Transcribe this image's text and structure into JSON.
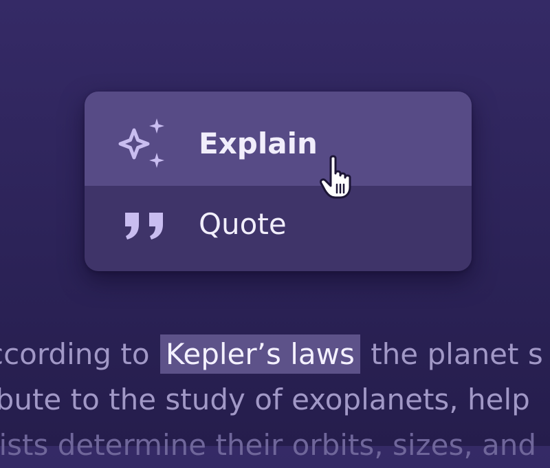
{
  "context_menu": {
    "items": [
      {
        "label": "Explain",
        "icon": "sparkles-icon",
        "active": true
      },
      {
        "label": "Quote",
        "icon": "quote-icon",
        "active": false
      }
    ]
  },
  "passage": {
    "line1_before": "ccording to",
    "line1_highlight": "Kepler’s laws",
    "line1_after": "the planet s",
    "line2": "ibute to the study of exoplanets, help",
    "line3": "tists determine their orbits, sizes, and"
  },
  "colors": {
    "background": "#2e255b",
    "menu": "#3f3469",
    "menu_hover": "#574b86",
    "icon_accent": "#c9bdf0",
    "highlight": "#5d5289"
  }
}
